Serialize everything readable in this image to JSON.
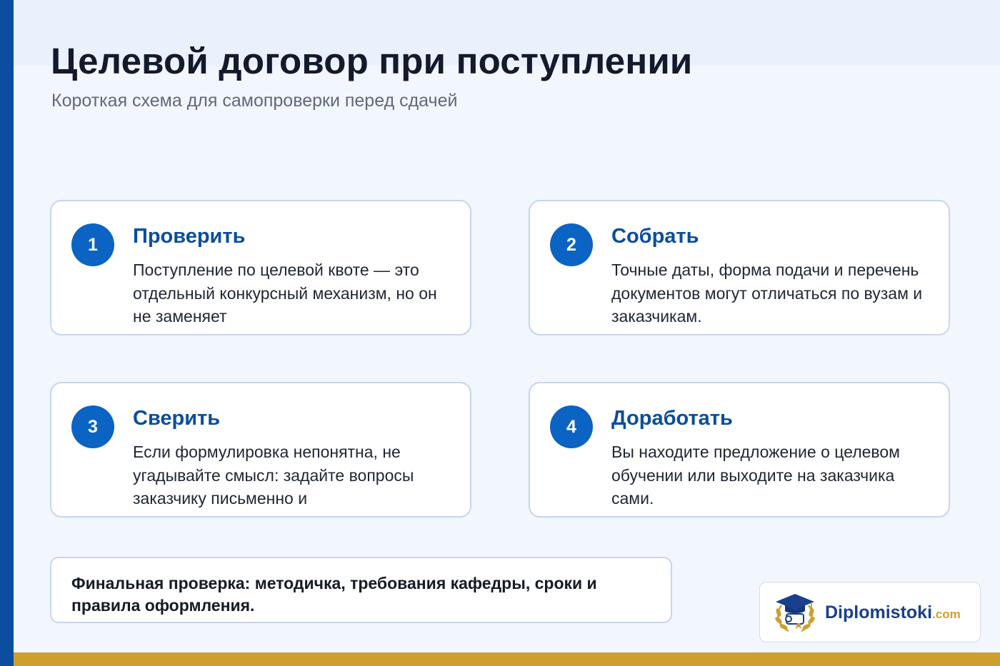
{
  "header": {
    "title": "Целевой договор при поступлении",
    "subtitle": "Короткая схема для самопроверки перед сдачей"
  },
  "cards": [
    {
      "number": "1",
      "title": "Проверить",
      "text": "Поступление по целевой квоте — это отдельный конкурсный механизм, но он не заменяет"
    },
    {
      "number": "2",
      "title": "Собрать",
      "text": "Точные даты, форма подачи и перечень документов могут отличаться по вузам и заказчикам."
    },
    {
      "number": "3",
      "title": "Сверить",
      "text": "Если формулировка непонятна, не угадывайте смысл: задайте вопросы заказчику письменно и"
    },
    {
      "number": "4",
      "title": "Доработать",
      "text": "Вы находите предложение о целевом обучении или выходите на заказчика сами."
    }
  ],
  "final_note": "Финальная проверка: методичка, требования кафедры, сроки и правила оформления.",
  "logo": {
    "name": "Diplomistoki",
    "suffix": ".com",
    "icon": "graduation-cap-laurel-icon"
  },
  "colors": {
    "accent_blue": "#0b63c4",
    "brand_dark_blue": "#0b4d9e",
    "gold": "#cf9f2e",
    "background": "#f2f6fd"
  }
}
